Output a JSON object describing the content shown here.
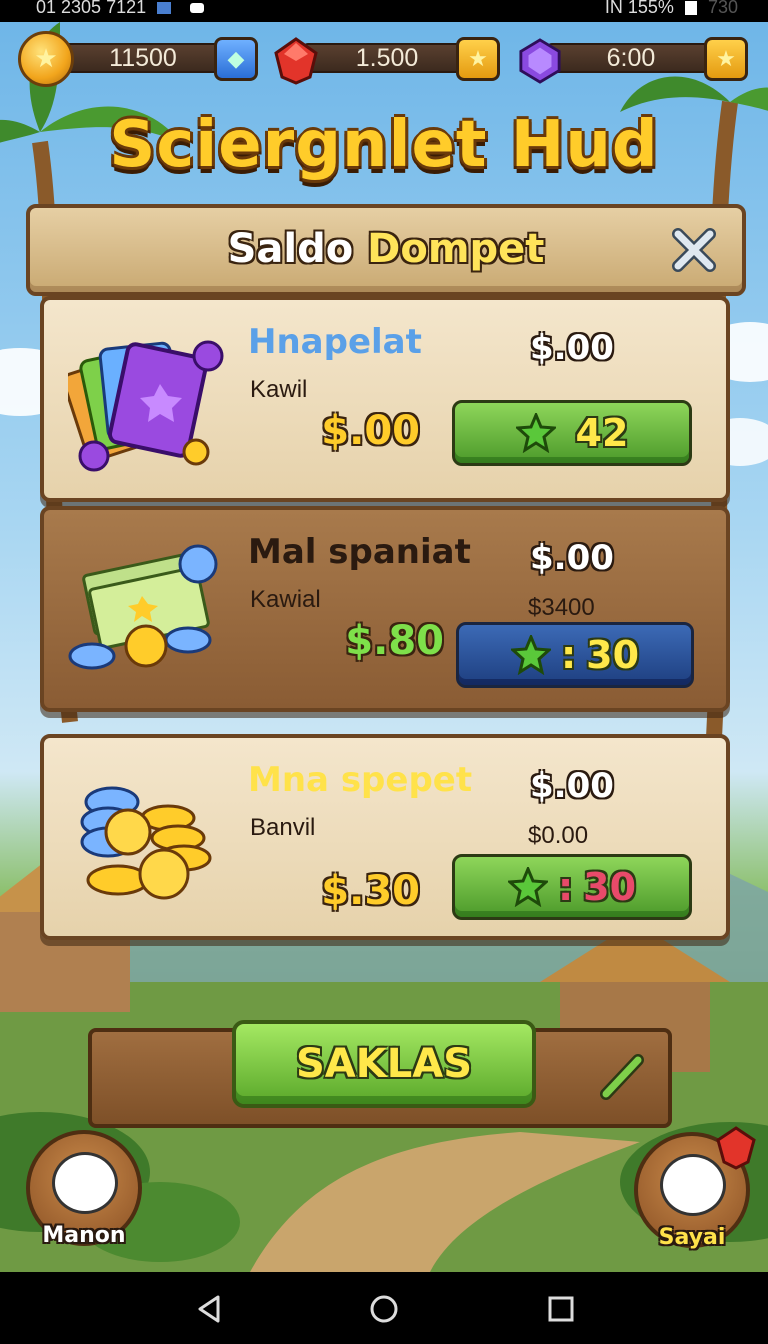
{
  "status_bar": {
    "left_text": "01 2305 7121",
    "right_text": "IN 155%",
    "right_extra": "730"
  },
  "resources": {
    "gold": "11500",
    "ruby": "1.500",
    "amethyst": "6:00"
  },
  "title": "Sciergnlet Hud",
  "panel": {
    "title_part1": "Saldo ",
    "title_part2": "Dompet"
  },
  "wallets": [
    {
      "name": "Hnapelat",
      "sub": "Kawil",
      "value_top": "$.00",
      "value_sub": "",
      "amount": "$.00",
      "button_label": "42",
      "button_sep": "",
      "name_color": "#5aa0e8",
      "amount_color": "#ffcc2a",
      "button_text_color": "#ffe84a",
      "style": "light",
      "button_style": "green"
    },
    {
      "name": "Mal spaniat",
      "sub": "Kawial",
      "value_top": "$.00",
      "value_sub": "$3400",
      "amount": "$.80",
      "button_label": "30",
      "button_sep": ":",
      "name_color": "#2a1a10",
      "amount_color": "#7ee04a",
      "button_text_color": "#ffe84a",
      "style": "dark",
      "button_style": "navy"
    },
    {
      "name": "Mna spepet",
      "sub": "Banvil",
      "value_top": "$.00",
      "value_sub": "$0.00",
      "amount": "$.30",
      "button_label": "30",
      "button_sep": ":",
      "name_color": "#ffe24a",
      "amount_color": "#ffcc2a",
      "button_text_color": "#e84a6a",
      "style": "light",
      "button_style": "green"
    }
  ],
  "save_button": "SAKLAS",
  "avatars": {
    "left": "Manon",
    "right": "Sayai"
  },
  "colors": {
    "wood_dark": "#6a4422",
    "gold": "#ffcc2a",
    "green": "#5aa82a"
  }
}
